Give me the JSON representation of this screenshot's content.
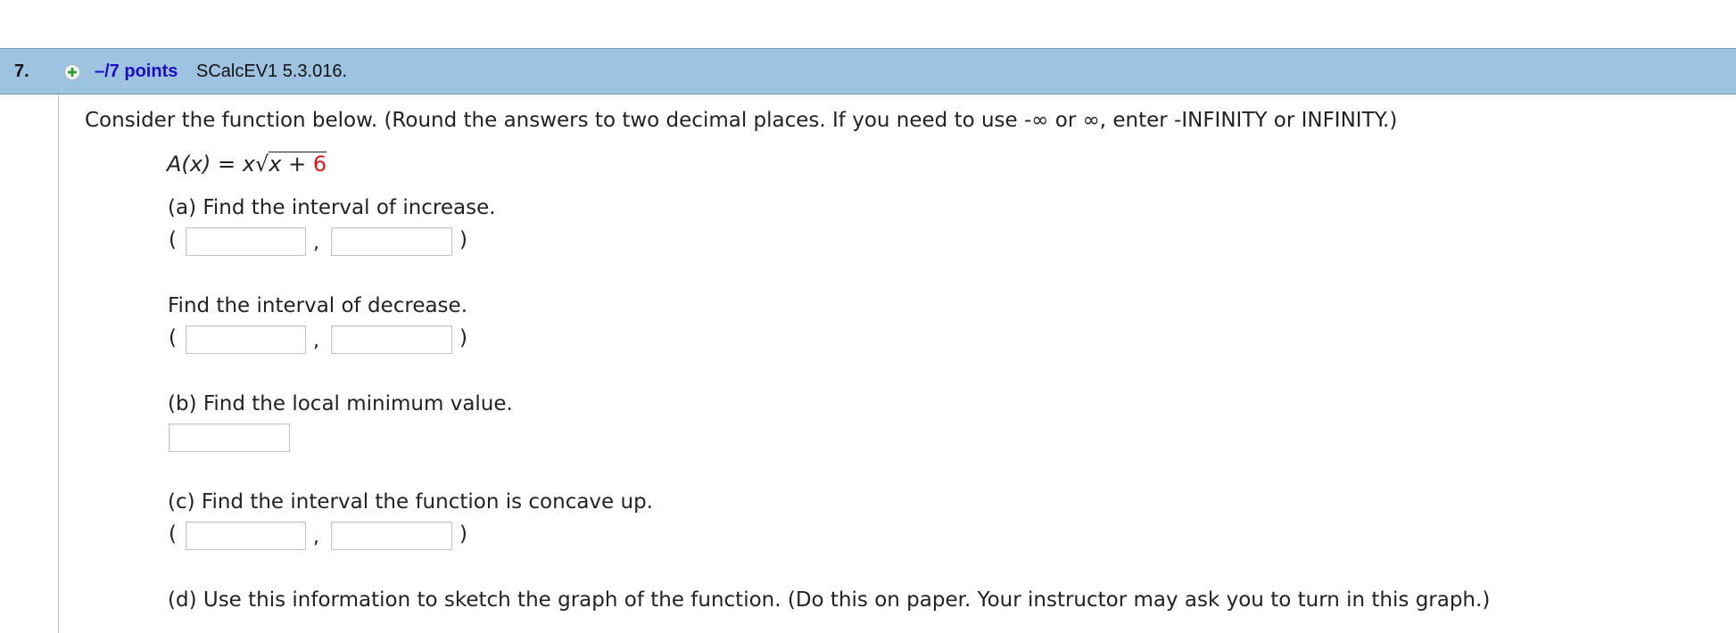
{
  "question": {
    "number": "7.",
    "points": "–/7 points",
    "source": "SCalcEV1 5.3.016."
  },
  "instructions": "Consider the function below. (Round the answers to two decimal places. If you need to use -∞ or ∞, enter -INFINITY or INFINITY.)",
  "formula": {
    "lhs": "A(x)",
    "equals": "=",
    "x": "x",
    "radical_sign": "√",
    "radicand_var": "x",
    "plus": "+",
    "constant": "6"
  },
  "parts": {
    "a_increase": "(a) Find the interval of increase.",
    "a_decrease": "Find the interval of decrease.",
    "b_local_min": "(b) Find the local minimum value.",
    "c_concave_up": "(c) Find the interval the function is concave up.",
    "d_sketch": "(d) Use this information to sketch the graph of the function. (Do this on paper. Your instructor may ask you to turn in this graph.)"
  },
  "symbols": {
    "open_paren": "(",
    "close_paren": ")",
    "comma": ","
  },
  "inputs": {
    "increase_left": "",
    "increase_right": "",
    "decrease_left": "",
    "decrease_right": "",
    "local_min": "",
    "concave_left": "",
    "concave_right": ""
  },
  "colors": {
    "header_bg": "#9ec3e0",
    "points_link": "#1a0dc4",
    "constant_red": "#e0191f",
    "add_icon_green": "#2e9c2e"
  },
  "icons": {
    "add": "plus-circle-icon"
  }
}
